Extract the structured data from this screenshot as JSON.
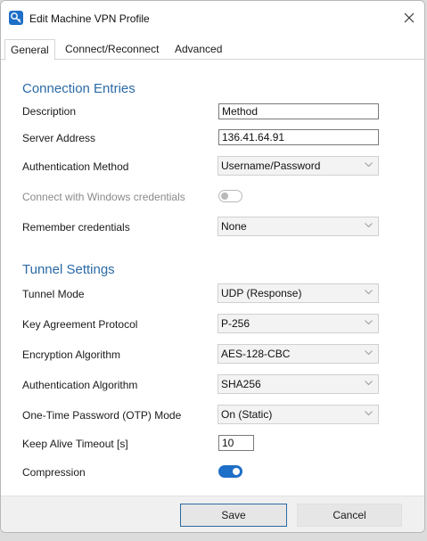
{
  "window": {
    "title": "Edit Machine VPN Profile"
  },
  "tabs": [
    {
      "label": "General"
    },
    {
      "label": "Connect/Reconnect"
    },
    {
      "label": "Advanced"
    }
  ],
  "connection": {
    "heading": "Connection Entries",
    "description": {
      "label": "Description",
      "value": "Method"
    },
    "server": {
      "label": "Server Address",
      "value": "136.41.64.91"
    },
    "auth_method": {
      "label": "Authentication Method",
      "value": "Username/Password"
    },
    "windows_creds": {
      "label": "Connect with Windows credentials",
      "state": "off"
    },
    "remember": {
      "label": "Remember credentials",
      "value": "None"
    }
  },
  "tunnel": {
    "heading": "Tunnel Settings",
    "mode": {
      "label": "Tunnel Mode",
      "value": "UDP (Response)"
    },
    "key_agreement": {
      "label": "Key Agreement Protocol",
      "value": "P-256"
    },
    "encryption": {
      "label": "Encryption Algorithm",
      "value": "AES-128-CBC"
    },
    "authentication": {
      "label": "Authentication Algorithm",
      "value": "SHA256"
    },
    "otp": {
      "label": "One-Time Password (OTP) Mode",
      "value": "On (Static)"
    },
    "keepalive": {
      "label": "Keep Alive Timeout [s]",
      "value": "10"
    },
    "compression": {
      "label": "Compression",
      "state": "on"
    }
  },
  "footer": {
    "save_label": "Save",
    "cancel_label": "Cancel"
  },
  "colors": {
    "accent": "#1e6fc7",
    "heading": "#2b6aa6"
  },
  "icons": {
    "app": "vpn-profile-icon",
    "close": "close-icon",
    "dropdown": "chevron-down-icon"
  }
}
